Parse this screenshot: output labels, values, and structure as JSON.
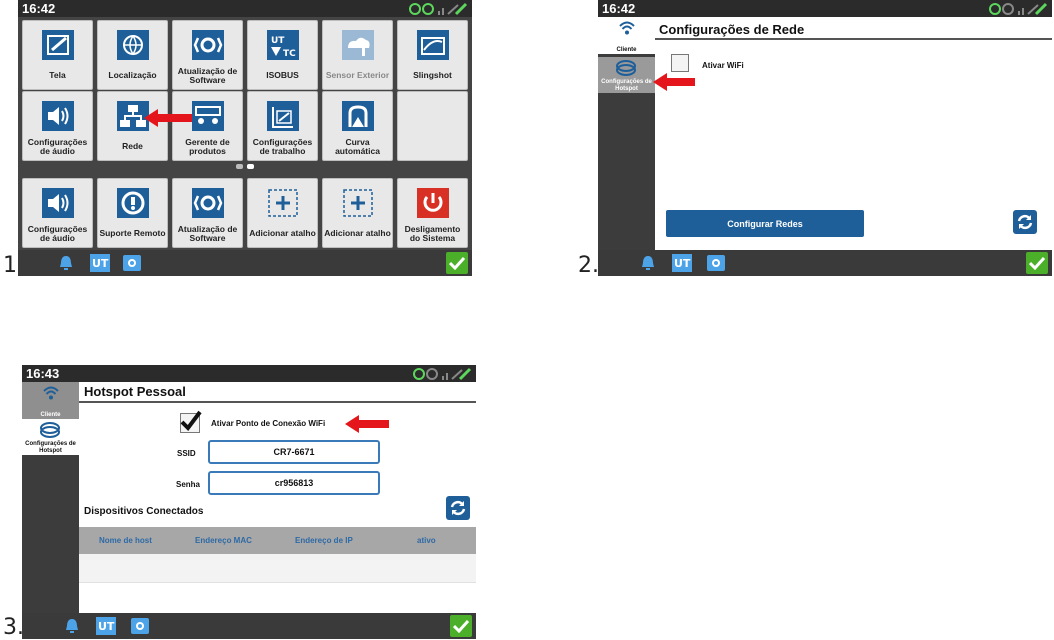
{
  "labels": {
    "n1": "1.",
    "n2": "2.",
    "n3": "3."
  },
  "screen1": {
    "time": "16:42",
    "tiles": [
      {
        "label": "Tela",
        "icon": "display-settings-icon"
      },
      {
        "label": "Localização",
        "icon": "globe-icon"
      },
      {
        "label": "Atualização de Software",
        "icon": "software-update-icon"
      },
      {
        "label": "ISOBUS",
        "icon": "isobus-icon"
      },
      {
        "label": "Sensor Exterior",
        "icon": "weather-sensor-icon"
      },
      {
        "label": "Slingshot",
        "icon": "slingshot-icon"
      },
      {
        "label": "Configurações de áudio",
        "icon": "speaker-icon"
      },
      {
        "label": "Rede",
        "icon": "network-icon"
      },
      {
        "label": "Gerente de produtos",
        "icon": "product-manager-icon"
      },
      {
        "label": "Configurações de trabalho",
        "icon": "job-settings-icon"
      },
      {
        "label": "Curva automática",
        "icon": "auto-turn-icon"
      },
      {
        "label": "Configurações de áudio",
        "icon": "speaker-icon"
      },
      {
        "label": "Suporte Remoto",
        "icon": "remote-support-icon"
      },
      {
        "label": "Atualização de Software",
        "icon": "software-update-icon"
      },
      {
        "label": "Adicionar atalho",
        "icon": "add-shortcut-icon"
      },
      {
        "label": "Adicionar atalho",
        "icon": "add-shortcut-icon"
      },
      {
        "label": "Desligamento do Sistema",
        "icon": "power-icon"
      }
    ]
  },
  "screen2": {
    "time": "16:42",
    "title": "Configurações de Rede",
    "side_client": "Cliente",
    "side_hotspot": "Configurações de Hotspot",
    "wifi_label": "Ativar WiFi",
    "configure_button": "Configurar Redes"
  },
  "screen3": {
    "time": "16:43",
    "title": "Hotspot Pessoal",
    "side_client": "Cliente",
    "side_hotspot": "Configurações de Hotspot",
    "hotspot_label": "Ativar Ponto de Conexão WiFi",
    "ssid_label": "SSID",
    "ssid_value": "CR7-6671",
    "password_label": "Senha",
    "password_value": "cr956813",
    "devices_title": "Dispositivos Conectados",
    "columns": [
      "Nome de host",
      "Endereço MAC",
      "Endereço de IP",
      "ativo"
    ]
  },
  "colors": {
    "accent": "#1f5f99",
    "ok": "#4caf2a",
    "arrow": "#e4161b"
  }
}
